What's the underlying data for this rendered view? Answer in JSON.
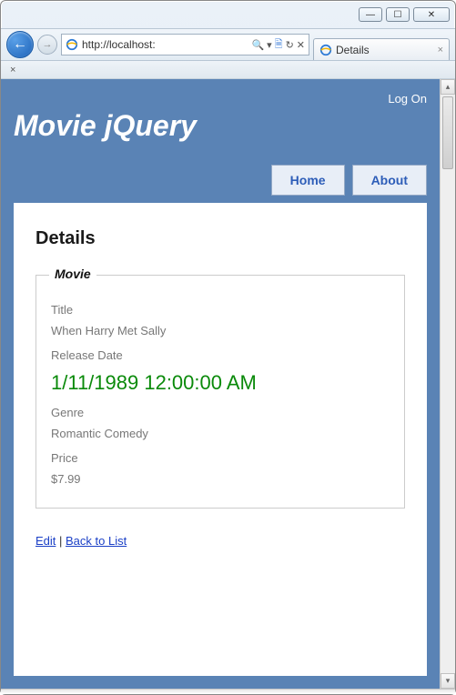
{
  "window": {
    "minimize_glyph": "—",
    "maximize_glyph": "☐",
    "close_glyph": "✕"
  },
  "browser": {
    "back_glyph": "←",
    "forward_glyph": "→",
    "address": "http://localhost:",
    "search_glyph": "🔍",
    "dropdown_glyph": "▾",
    "compat_glyph": "🗎",
    "refresh_glyph": "↻",
    "stop_glyph": "✕",
    "tab_title": "Details",
    "tab_close_glyph": "×",
    "subrow_close_glyph": "×"
  },
  "page": {
    "logon": "Log On",
    "site_title": "Movie jQuery",
    "nav": {
      "home": "Home",
      "about": "About"
    },
    "heading": "Details",
    "fieldset_legend": "Movie",
    "labels": {
      "title": "Title",
      "release_date": "Release Date",
      "genre": "Genre",
      "price": "Price"
    },
    "movie": {
      "title": "When Harry Met Sally",
      "release_date": "1/11/1989 12:00:00 AM",
      "genre": "Romantic Comedy",
      "price": "$7.99"
    },
    "links": {
      "edit": "Edit",
      "back": "Back to List",
      "separator": " | "
    }
  },
  "scrollbar": {
    "up_glyph": "▴",
    "down_glyph": "▾"
  }
}
